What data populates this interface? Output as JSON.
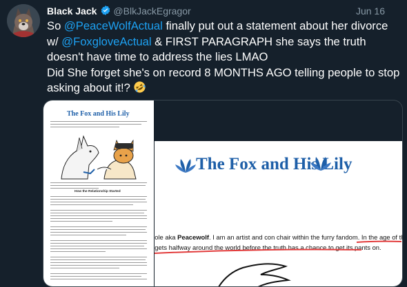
{
  "author": {
    "name": "Black Jack",
    "handle": "@BlkJackEgragor",
    "date": "Jun 16",
    "avatar_icon": "wolf-avatar-icon",
    "verified_icon": "verified-badge-icon"
  },
  "tweet": {
    "line1_pre": "So ",
    "mention1": "@PeaceWolfActual",
    "line1_post": " finally put out a statement about her divorce w/ ",
    "mention2": "@FoxgloveActual",
    "line2_post": " & FIRST PARAGRAPH she says the truth doesn't have time to address the lies LMAO\nDid She forget she's on record 8 MONTHS AGO telling people to stop asking about it!? ",
    "emoji": "rolling-on-floor-laughing-emoji"
  },
  "doc": {
    "title": "The Fox and His Lily",
    "subtitle": "How the Relationship Started"
  },
  "crop": {
    "title": "The Fox and His Lily",
    "line1": "y name is Nicole aka ",
    "line1_bold": "Peacewolf",
    "line1_post": ". I am an artist and con chair within the furry fandom. In the age of the",
    "line2": "internet, a lie gets halfway around the world before the truth has a chance to get its pants on."
  },
  "colors": {
    "accent": "#1da1f2",
    "underline": "#e23b3b",
    "doc_title": "#1e5fa8"
  }
}
